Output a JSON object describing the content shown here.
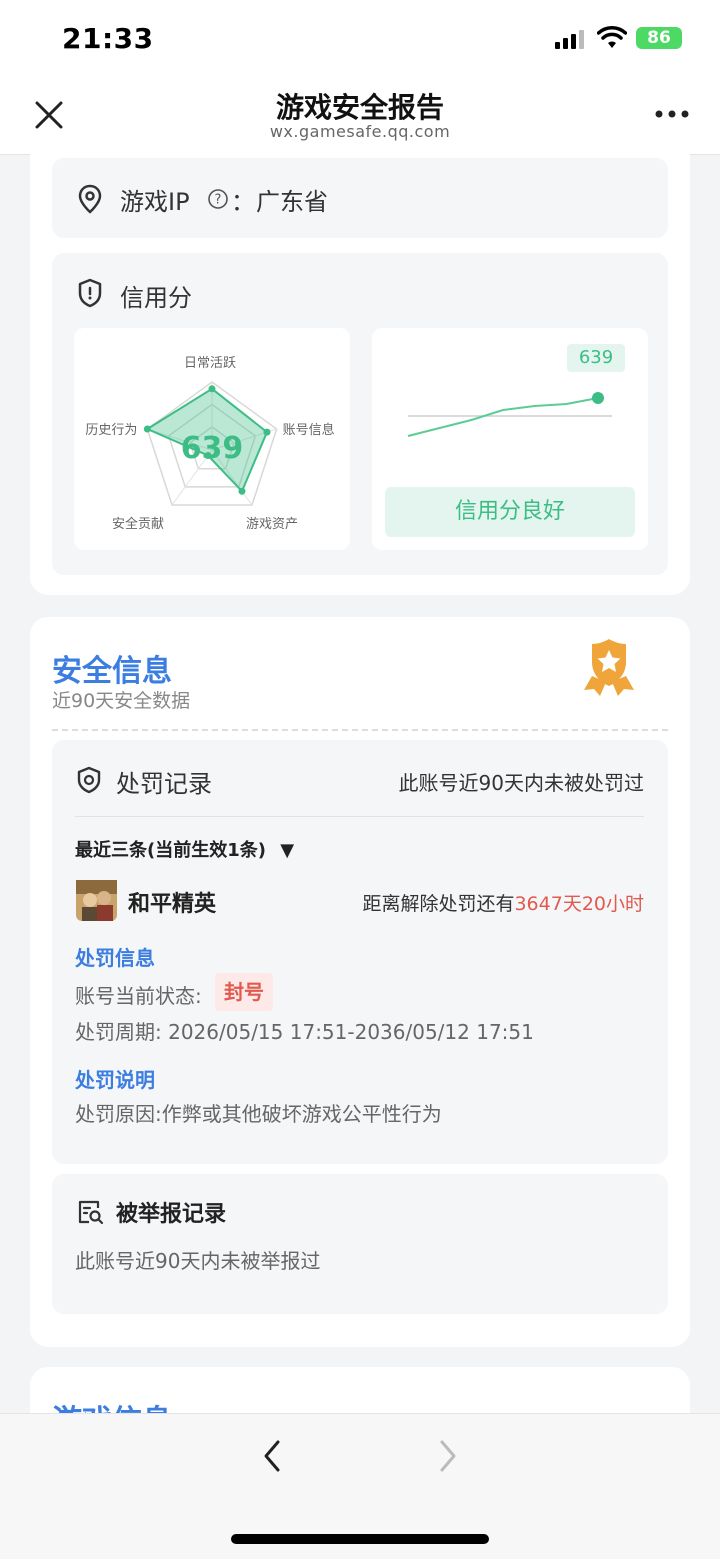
{
  "status": {
    "time": "21:33",
    "battery": "86"
  },
  "nav": {
    "title": "游戏安全报告",
    "subtitle": "wx.gamesafe.qq.com"
  },
  "ip": {
    "label": "游戏IP",
    "sep": "：",
    "value": "广东省"
  },
  "credit": {
    "title": "信用分",
    "score": "639",
    "status_label": "信用分良好",
    "radar": {
      "axes": [
        "日常活跃",
        "账号信息",
        "游戏资产",
        "安全贡献",
        "历史行为"
      ],
      "values": [
        0.9,
        0.85,
        0.75,
        0.1,
        1.0
      ]
    },
    "trend": {
      "values": [
        620,
        624,
        628,
        633,
        635,
        636,
        639
      ],
      "baseline": 630
    }
  },
  "security": {
    "title": "安全信息",
    "subtitle": "近90天安全数据",
    "punish": {
      "title": "处罚记录",
      "summary": "此账号近90天内未被处罚过",
      "recent": "最近三条(当前生效1条)",
      "game": "和平精英",
      "countdown_prefix": "距离解除处罚还有",
      "countdown_value": "3647天20小时",
      "info_label": "处罚信息",
      "status_label": "账号当前状态:",
      "status_value": "封号",
      "period_label": "处罚周期:",
      "period_value": "2026/05/15 17:51-2036/05/12 17:51",
      "explain_label": "处罚说明",
      "reason": "处罚原因:作弊或其他破坏游戏公平性行为"
    },
    "report": {
      "title": "被举报记录",
      "text": "此账号近90天内未被举报过"
    }
  },
  "next_section": {
    "title": "游戏信息"
  },
  "colors": {
    "accent": "#3b7de0",
    "green": "#3dbd86",
    "red": "#e05a4f",
    "gold": "#f0a53a"
  }
}
